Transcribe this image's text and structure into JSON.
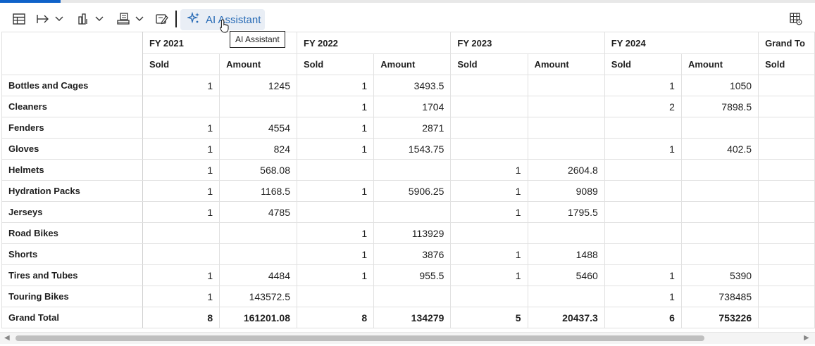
{
  "toolbar": {
    "ai_label": "AI Assistant",
    "tooltip": "AI Assistant",
    "progress": 0.074
  },
  "grid": {
    "years": [
      "FY 2021",
      "FY 2022",
      "FY 2023",
      "FY 2024",
      "Grand To"
    ],
    "measures": [
      "Sold",
      "Amount",
      "Sold",
      "Amount",
      "Sold",
      "Amount",
      "Sold",
      "Amount",
      "Sold"
    ],
    "rows": [
      {
        "label": "Bottles and Cages",
        "cells": [
          "1",
          "1245",
          "1",
          "3493.5",
          "",
          "",
          "1",
          "1050",
          ""
        ]
      },
      {
        "label": "Cleaners",
        "cells": [
          "",
          "",
          "1",
          "1704",
          "",
          "",
          "2",
          "7898.5",
          ""
        ]
      },
      {
        "label": "Fenders",
        "cells": [
          "1",
          "4554",
          "1",
          "2871",
          "",
          "",
          "",
          "",
          ""
        ]
      },
      {
        "label": "Gloves",
        "cells": [
          "1",
          "824",
          "1",
          "1543.75",
          "",
          "",
          "1",
          "402.5",
          ""
        ]
      },
      {
        "label": "Helmets",
        "cells": [
          "1",
          "568.08",
          "",
          "",
          "1",
          "2604.8",
          "",
          "",
          ""
        ]
      },
      {
        "label": "Hydration Packs",
        "cells": [
          "1",
          "1168.5",
          "1",
          "5906.25",
          "1",
          "9089",
          "",
          "",
          ""
        ]
      },
      {
        "label": "Jerseys",
        "cells": [
          "1",
          "4785",
          "",
          "",
          "1",
          "1795.5",
          "",
          "",
          ""
        ]
      },
      {
        "label": "Road Bikes",
        "cells": [
          "",
          "",
          "1",
          "113929",
          "",
          "",
          "",
          "",
          ""
        ]
      },
      {
        "label": "Shorts",
        "cells": [
          "",
          "",
          "1",
          "3876",
          "1",
          "1488",
          "",
          "",
          ""
        ]
      },
      {
        "label": "Tires and Tubes",
        "cells": [
          "1",
          "4484",
          "1",
          "955.5",
          "1",
          "5460",
          "1",
          "5390",
          ""
        ]
      },
      {
        "label": "Touring Bikes",
        "cells": [
          "1",
          "143572.5",
          "",
          "",
          "",
          "",
          "1",
          "738485",
          ""
        ]
      }
    ],
    "total": {
      "label": "Grand Total",
      "cells": [
        "8",
        "161201.08",
        "8",
        "134279",
        "5",
        "20437.3",
        "6",
        "753226",
        ""
      ]
    }
  }
}
